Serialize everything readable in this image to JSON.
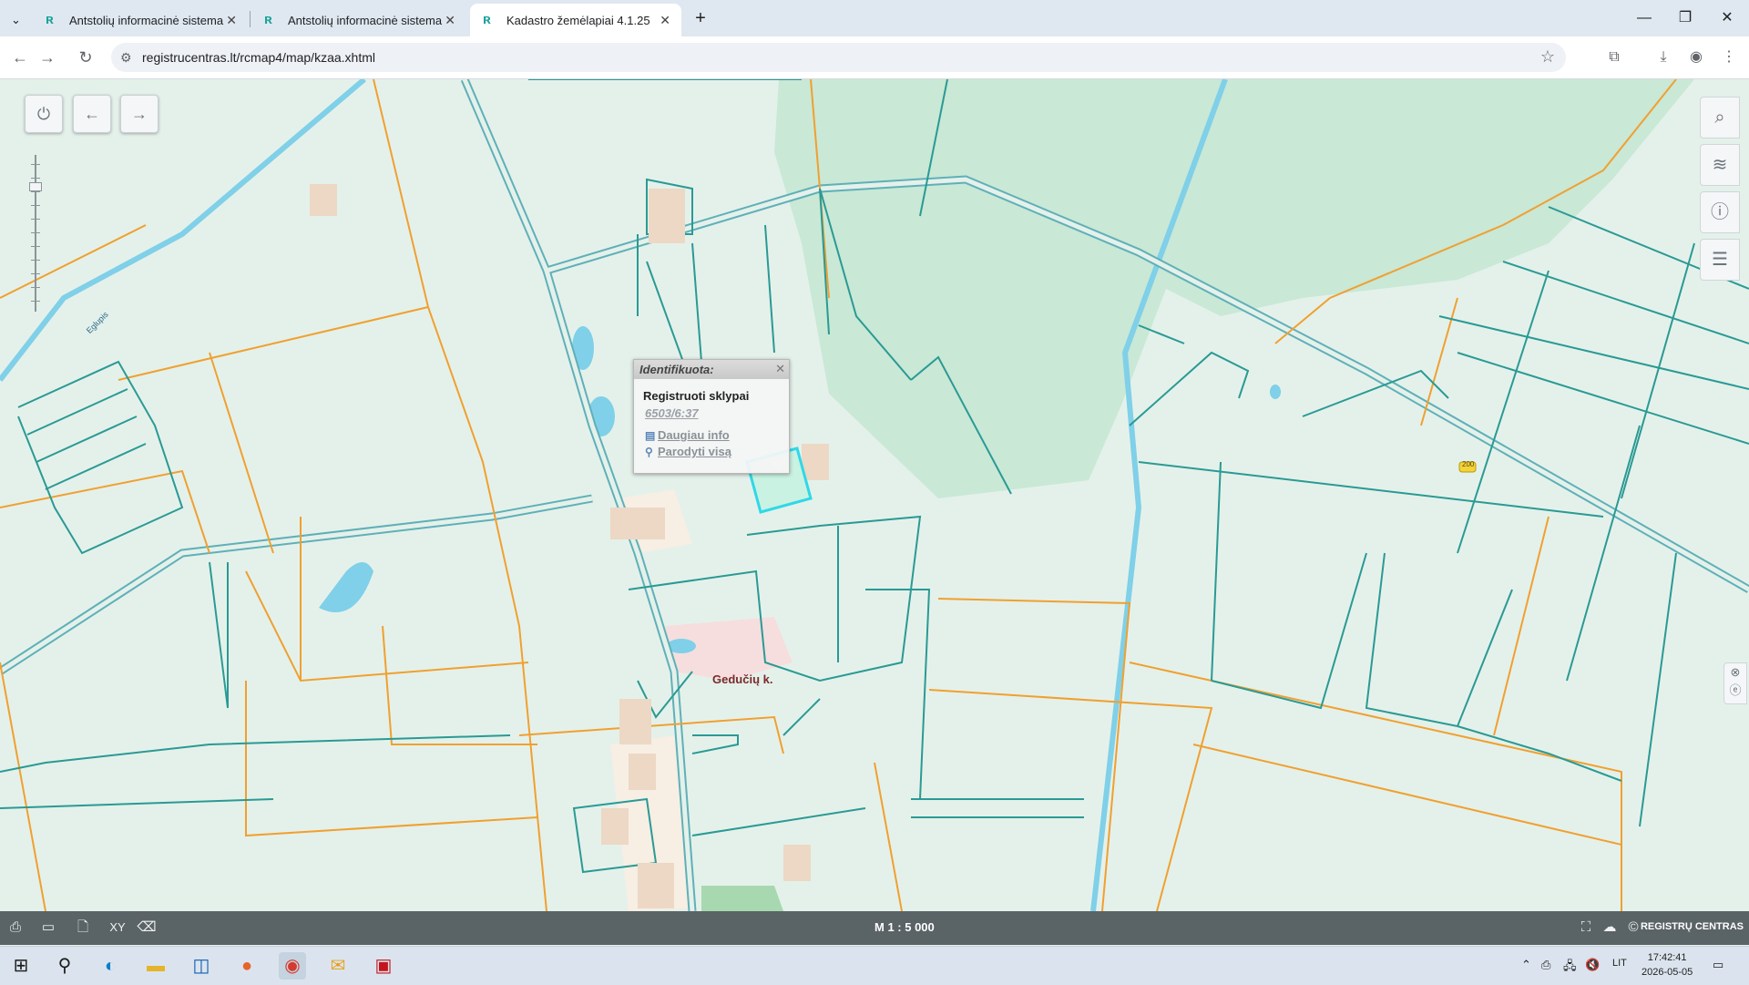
{
  "browser": {
    "tabs": [
      {
        "title": "Antstolių informacinė sistema",
        "active": false
      },
      {
        "title": "Antstolių informacinė sistema",
        "active": false
      },
      {
        "title": "Kadastro žemėlapiai 4.1.25",
        "active": true
      }
    ],
    "url": "registrucentras.lt/rcmap4/map/kzaa.xhtml"
  },
  "map": {
    "popup": {
      "header": "Identifikuota:",
      "title": "Registruoti sklypai",
      "parcel_id": "6503/6:37",
      "link_more": "Daugiau info",
      "link_show": "Parodyti visą"
    },
    "labels": {
      "village": "Gedučių k.",
      "river": "Eglupis",
      "road_number": "200"
    },
    "scale": "M 1 : 5 000",
    "brand": "REGISTRŲ CENTRAS"
  },
  "taskbar": {
    "language": "LIT",
    "time": "17:42:41",
    "date": "2026-05-05"
  },
  "colors": {
    "parcel_line": "#2a9a94",
    "boundary_line": "#f0a030",
    "road": "#7fc4cf",
    "forest": "#c8e8d8",
    "water": "#7fd0e8",
    "highlight": "#2fd8e8"
  }
}
